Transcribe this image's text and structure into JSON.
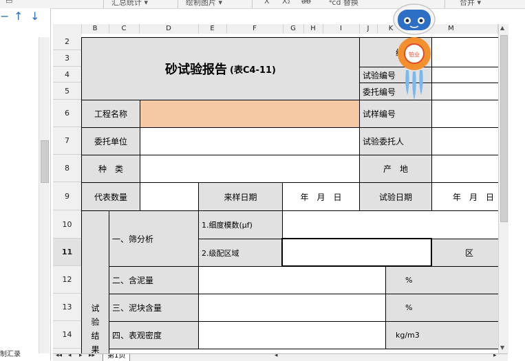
{
  "toolbar": {
    "items": [
      "汇总统计 ▾",
      "绘制图片 ▾",
      "X",
      "X₂",
      "ab",
      "⁴cd 替换",
      "合并 ▾"
    ]
  },
  "left_panel": {
    "up_arrow": "↑",
    "down_arrow": "↓",
    "minus": "−",
    "note": "制汇录"
  },
  "columns": [
    "B",
    "C",
    "D",
    "E",
    "F",
    "G",
    "H",
    "I",
    "J",
    "K",
    "M"
  ],
  "rows": [
    "2",
    "3",
    "4",
    "5",
    "6",
    "7",
    "8",
    "9",
    "10",
    "11",
    "12",
    "13",
    "14"
  ],
  "form": {
    "title": "砂试验报告",
    "table_code": "(表C4-11)",
    "number_label": "编号",
    "test_number_label": "试验编号",
    "commission_number_label": "委托编号",
    "project_name_label": "工程名称",
    "sample_number_label": "试样编号",
    "client_unit_label": "委托单位",
    "test_client_label": "试验委托人",
    "type_label": "种　类",
    "origin_label": "产　地",
    "quantity_label": "代表数量",
    "sampling_date_label": "来样日期",
    "date_placeholder_1": "年　月　日",
    "test_date_label": "试验日期",
    "date_placeholder_2": "年　月　日",
    "results_label": "试验结果",
    "sieve_analysis_label": "一、筛分析",
    "fineness_modulus_label": "1.细度模数(μf)",
    "grading_zone_label": "2.级配区域",
    "zone_unit": "区",
    "mud_content_label": "二、含泥量",
    "mud_unit": "%",
    "clay_lump_label": "三、泥块含量",
    "clay_unit": "%",
    "apparent_density_label": "四、表观密度",
    "density_unit": "kg/m3"
  },
  "sheet_tabs": {
    "tab1": "第1页"
  },
  "colors": {
    "header_gray": "#e1e1e1",
    "project_name_fill": "#f5c9a4",
    "mascot_body": "#f2902e",
    "mascot_face": "#2d6fc4",
    "mascot_flame": "#7ab8f0"
  },
  "mascot": {
    "badge_text": "铂业"
  }
}
